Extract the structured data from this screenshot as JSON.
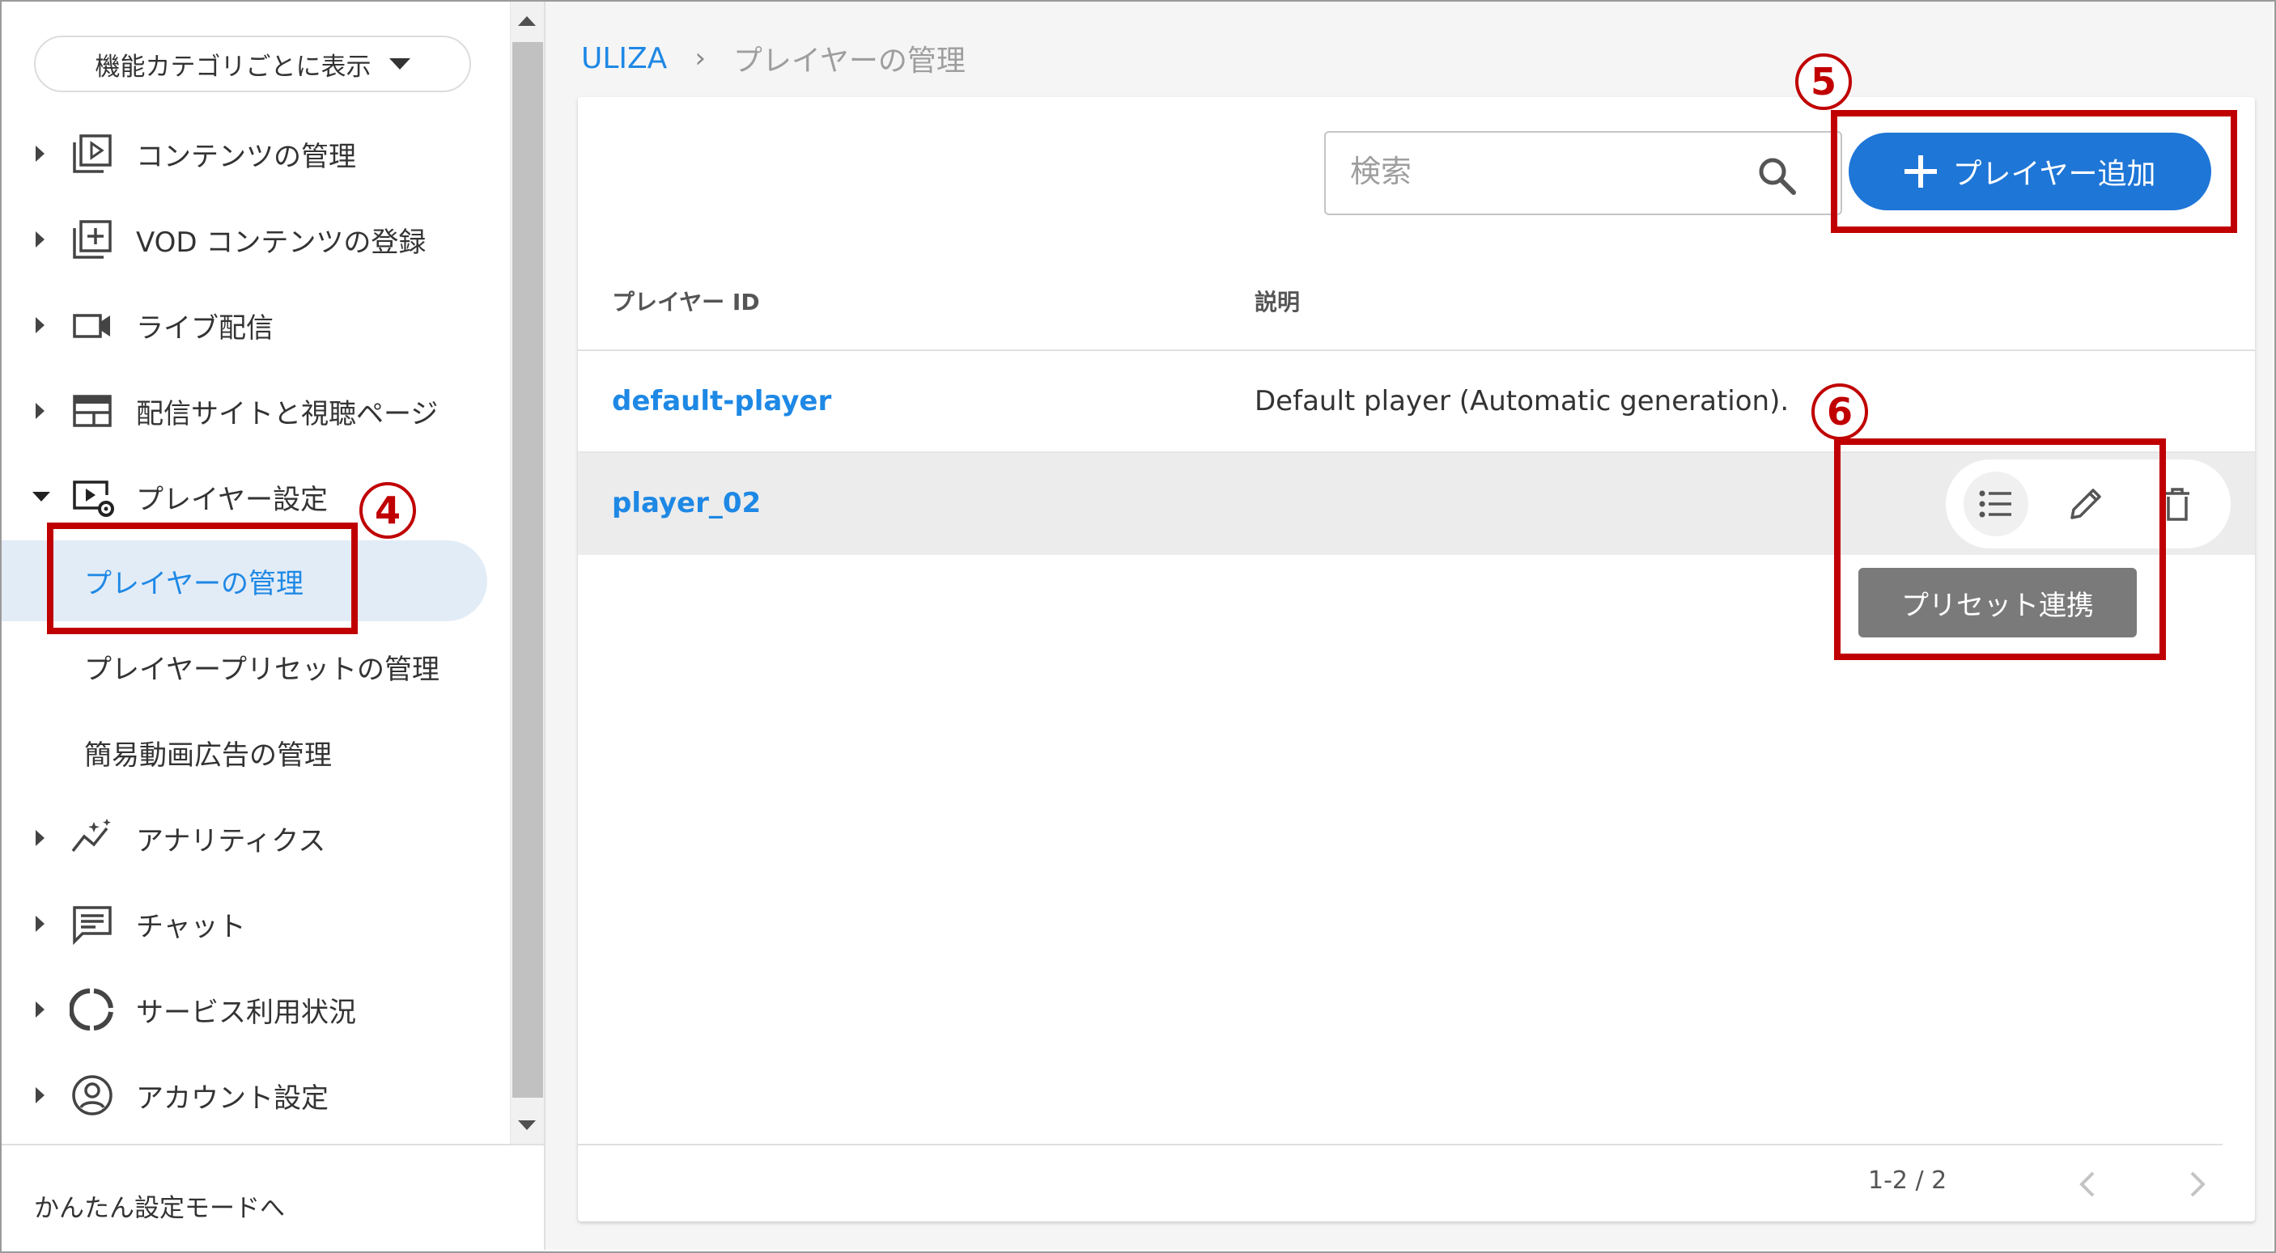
{
  "sidebar": {
    "category_dropdown": "機能カテゴリごとに表示",
    "items": [
      {
        "label": "コンテンツの管理",
        "icon": "play-box-icon"
      },
      {
        "label": "VOD コンテンツの登録",
        "icon": "add-box-icon"
      },
      {
        "label": "ライブ配信",
        "icon": "video-camera-icon"
      },
      {
        "label": "配信サイトと視聴ページ",
        "icon": "web-layout-icon"
      },
      {
        "label": "プレイヤー設定",
        "icon": "player-settings-icon",
        "expanded": true
      },
      {
        "label": "アナリティクス",
        "icon": "analytics-icon"
      },
      {
        "label": "チャット",
        "icon": "chat-icon"
      },
      {
        "label": "サービス利用状況",
        "icon": "donut-chart-icon"
      },
      {
        "label": "アカウント設定",
        "icon": "account-circle-icon"
      }
    ],
    "sub_items": [
      {
        "label": "プレイヤーの管理",
        "active": true
      },
      {
        "label": "プレイヤープリセットの管理",
        "active": false
      },
      {
        "label": "簡易動画広告の管理",
        "active": false
      }
    ],
    "footer_link": "かんたん設定モードへ"
  },
  "breadcrumb": {
    "root": "ULIZA",
    "separator": "›",
    "current": "プレイヤーの管理"
  },
  "toolbar": {
    "search_placeholder": "検索",
    "add_button_label": "プレイヤー追加"
  },
  "table": {
    "columns": [
      "プレイヤー ID",
      "説明"
    ],
    "rows": [
      {
        "id": "default-player",
        "description": "Default player (Automatic generation)."
      },
      {
        "id": "player_02",
        "description": ""
      }
    ]
  },
  "row_actions": {
    "icons": [
      "list-icon",
      "edit-pencil-icon",
      "delete-trash-icon"
    ],
    "tooltip": "プリセット連携"
  },
  "pagination": {
    "range": "1-2 / 2"
  },
  "annotations": {
    "n4": "4",
    "n5": "5",
    "n6": "6"
  },
  "colors": {
    "accent": "#1e76d7",
    "link": "#1e88e5",
    "callout": "#c00000",
    "active_bg": "#e2ecf7"
  }
}
